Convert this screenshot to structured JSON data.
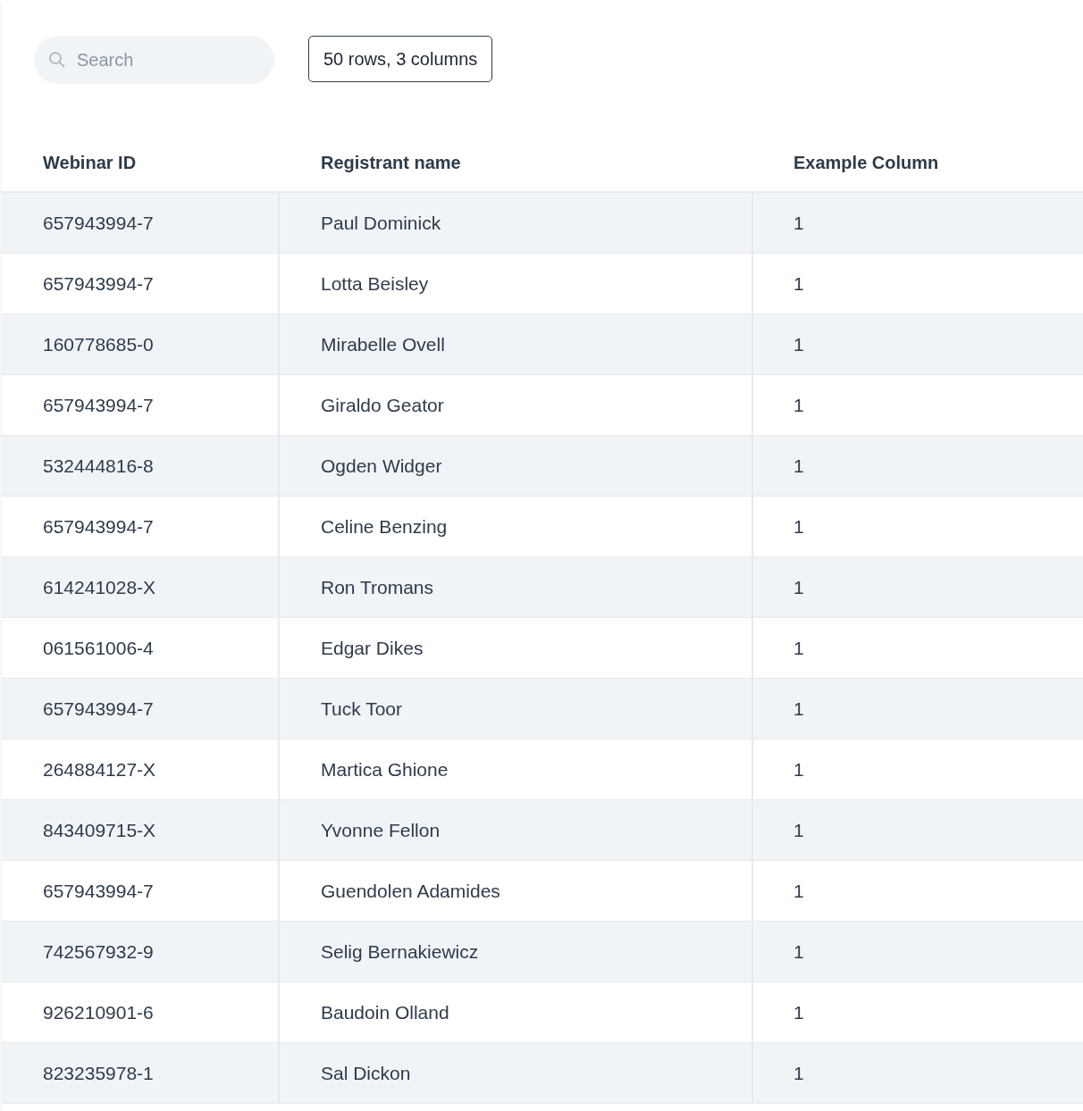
{
  "search": {
    "placeholder": "Search"
  },
  "summary_button": "50 rows, 3 columns",
  "table": {
    "columns": [
      "Webinar ID",
      "Registrant name",
      "Example Column"
    ],
    "rows": [
      [
        "657943994-7",
        "Paul Dominick",
        "1"
      ],
      [
        "657943994-7",
        "Lotta Beisley",
        "1"
      ],
      [
        "160778685-0",
        "Mirabelle Ovell",
        "1"
      ],
      [
        "657943994-7",
        "Giraldo Geator",
        "1"
      ],
      [
        "532444816-8",
        "Ogden Widger",
        "1"
      ],
      [
        "657943994-7",
        "Celine Benzing",
        "1"
      ],
      [
        "614241028-X",
        "Ron Tromans",
        "1"
      ],
      [
        "061561006-4",
        "Edgar Dikes",
        "1"
      ],
      [
        "657943994-7",
        "Tuck Toor",
        "1"
      ],
      [
        "264884127-X",
        "Martica Ghione",
        "1"
      ],
      [
        "843409715-X",
        "Yvonne Fellon",
        "1"
      ],
      [
        "657943994-7",
        "Guendolen Adamides",
        "1"
      ],
      [
        "742567932-9",
        "Selig Bernakiewicz",
        "1"
      ],
      [
        "926210901-6",
        "Baudoin Olland",
        "1"
      ],
      [
        "823235978-1",
        "Sal Dickon",
        "1"
      ]
    ]
  }
}
